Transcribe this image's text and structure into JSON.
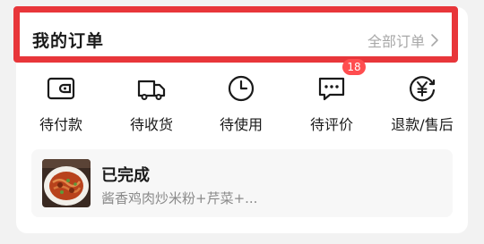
{
  "header": {
    "title": "我的订单",
    "all_orders_label": "全部订单"
  },
  "status_items": [
    {
      "label": "待付款",
      "icon": "wallet-icon"
    },
    {
      "label": "待收货",
      "icon": "truck-icon"
    },
    {
      "label": "待使用",
      "icon": "clock-icon"
    },
    {
      "label": "待评价",
      "icon": "comment-icon",
      "badge": "18"
    },
    {
      "label": "退款/售后",
      "icon": "yuan-refund-icon"
    }
  ],
  "recent_order": {
    "status": "已完成",
    "description": "酱香鸡肉炒米粉+芹菜+...",
    "image": "food-thumbnail"
  },
  "colors": {
    "highlight_border": "#e8363a",
    "badge": "#ff4d4f",
    "muted_text": "#a8a8a8"
  }
}
